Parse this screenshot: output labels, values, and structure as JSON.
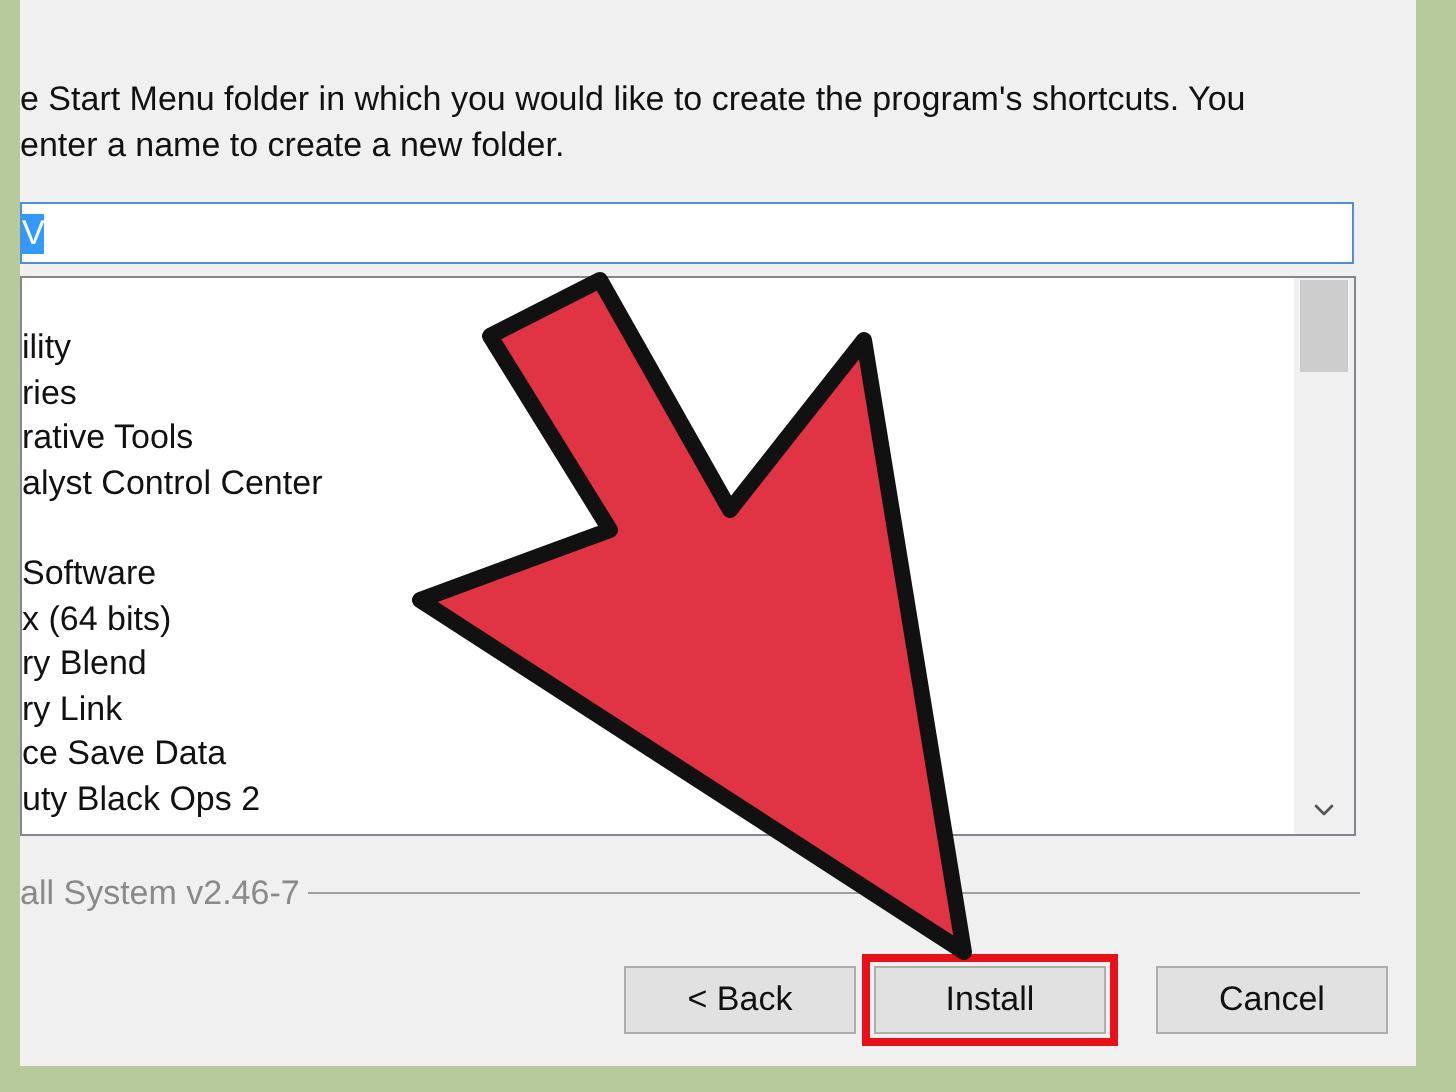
{
  "instructions": "e Start Menu folder in which you would like to create the program's shortcuts. You\nenter a name to create a new folder.",
  "folder_field": {
    "value": "V",
    "selected_text": true
  },
  "folder_list": [
    "ility",
    "ries",
    "rative Tools",
    "alyst Control Center",
    "Software",
    "x (64 bits)",
    "ry Blend",
    "ry Link",
    "ce Save Data",
    "uty Black Ops 2"
  ],
  "branding": "all System v2.46-7",
  "buttons": [
    {
      "label": "< Back",
      "highlighted": false
    },
    {
      "label": "Install",
      "highlighted": true
    },
    {
      "label": "Cancel",
      "highlighted": false
    }
  ]
}
